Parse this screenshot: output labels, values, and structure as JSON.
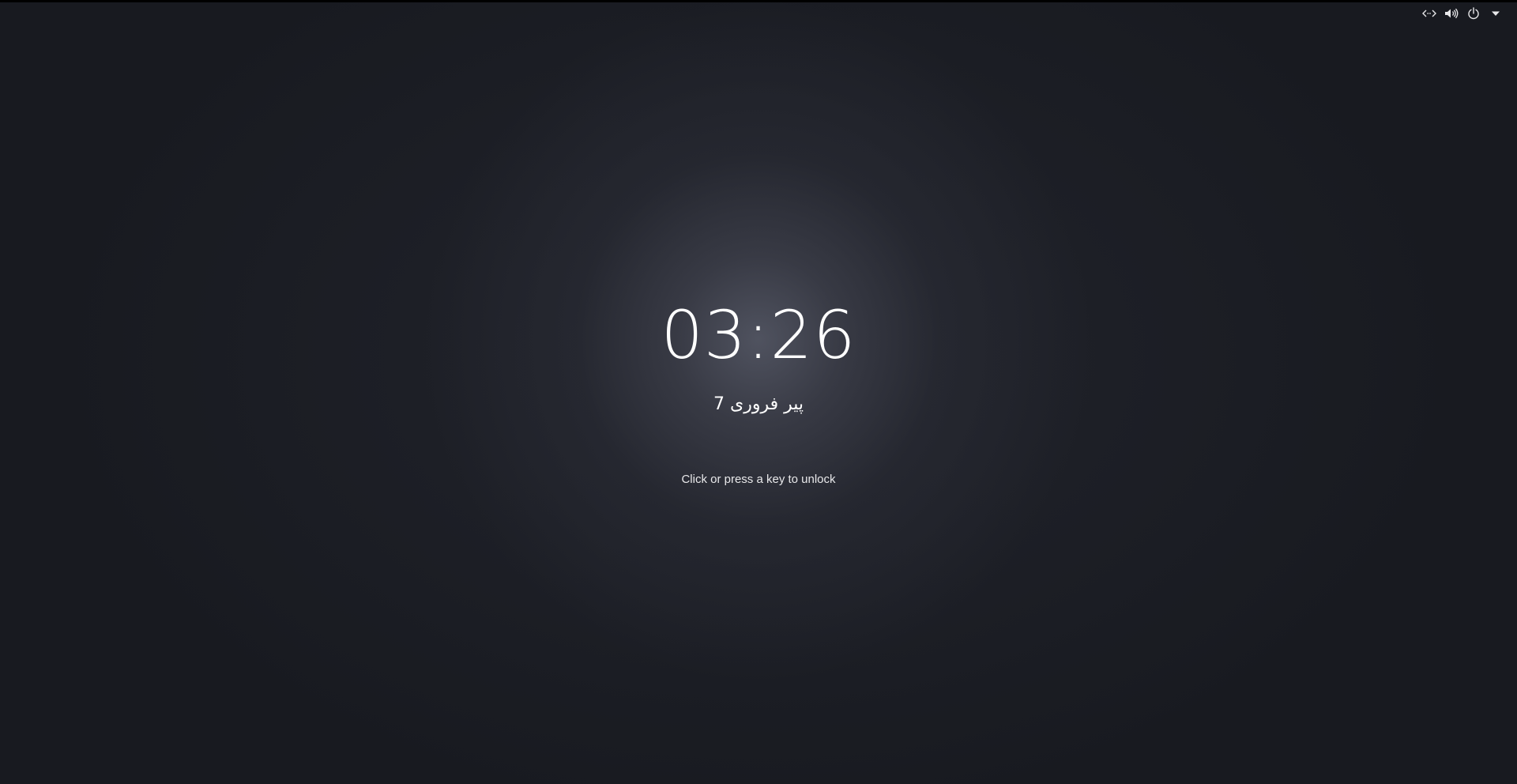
{
  "lock_screen": {
    "clock": "03:26",
    "date": "پیر فروری 7",
    "unlock_hint": "Click or press a key to unlock"
  },
  "status_bar": {
    "indicators": [
      {
        "icon": "network-wired-icon"
      },
      {
        "icon": "volume-icon"
      },
      {
        "icon": "power-icon"
      },
      {
        "icon": "menu-arrow-down-icon"
      }
    ]
  },
  "colors": {
    "background": "#1a1c23",
    "text": "#ffffff"
  }
}
